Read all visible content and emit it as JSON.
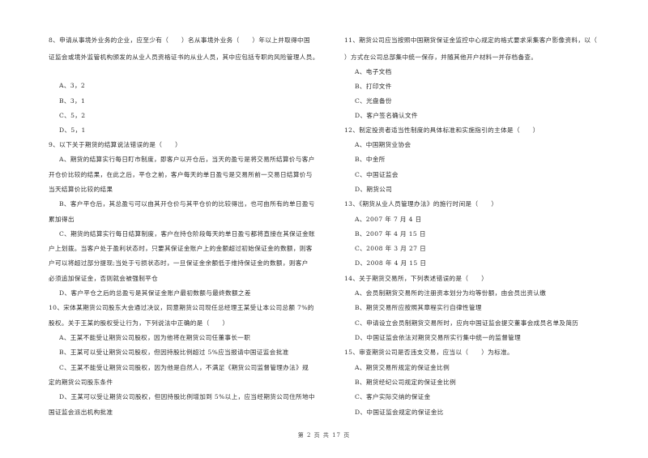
{
  "document": {
    "footer": "第 2 页 共 17 页",
    "left_column": [
      {
        "number": "8",
        "stem_lines": [
          "8、申请从事境外业务的企业，应至少有（　　）名从事境外业务（　　）年以上并取得中国",
          "证监会或境外监管机构颁发的从业人员资格证书的从业人员，其中应包括专职的风险管理人员。"
        ],
        "options": [
          "A、3，2",
          "B、3，1",
          "C、5，2",
          "D、5，1"
        ]
      },
      {
        "number": "9",
        "stem_lines": [
          "9、以下关于期货的结算说法错误的是（　　）"
        ],
        "options_lines": [
          [
            "A、期货的结算实行每日盯市制度，即客户以开仓后，当天的盈亏是将交易所结算价与客户",
            "开仓价比较的结果，在此之后，平仓之前，客户每天的单日盈亏是交易所前一交易日结算价与",
            "当天结算价比较的结果"
          ],
          [
            "B、客户平仓后，其总盈亏可以由其开仓价与其平仓价的比较得出，也可由所有的单日盈亏",
            "累加得出"
          ],
          [
            "C、期货的结算实行每日结算制度，客户在持仓阶段每天的单日盈亏都将直接在其保证金账",
            "户上划拨。当客户处于盈利状态时，只要其保证金账户上的金额超过初始保证金的数额，则客",
            "户可以将超过部分提现;当处于亏损状态时，一旦保证金余额低于维持保证金的数额，则客户",
            "必须追加保证金，否则就会被强制平仓"
          ],
          [
            "D、客户平仓之后的总盈亏是其保证金账户最初数额与最终数额之差"
          ]
        ]
      },
      {
        "number": "10",
        "stem_lines": [
          "10、宋体某期货公司股东大会通过决议，同意期货公司现任总经理王某受让本公司总额 7%的",
          "股权。关于王某的股权受让行为，下列说法中正确的是（　　）"
        ],
        "options_lines": [
          [
            "A、王某不能受让期货公司股权，因为他将在期货公司任董事长一职"
          ],
          [
            "B、王某可以受让期货公司股权，但因持股比例超过 5%应当报请中国证监会批准"
          ],
          [
            "C、王某不能受让期货公司股权，因为他是自然人，不满足《期货公司监督管理办法》规",
            "定的期货公司股东条件"
          ],
          [
            "D、王某可以受让期货公司股权，但因持股比例增加到 5%以上，应当经期货公司住所地中",
            "国证监会派出机构批准"
          ]
        ]
      }
    ],
    "right_column": [
      {
        "number": "11",
        "stem_lines": [
          "11、期货公司应当按照中国期货保证金监控中心规定的格式要求采集客户影像资料，以（",
          "）方式在公司总部集中统一保存，并随其他开户材料一并存档备查。"
        ],
        "options": [
          "A、电子文档",
          "B、打印文件",
          "C、光盘备份",
          "D、客户签名确认文件"
        ]
      },
      {
        "number": "12",
        "stem_lines": [
          "12、制定投资者适当性制度的具体标准和实施指引的主体是（　　）"
        ],
        "options": [
          "A、中国期货业协会",
          "B、中金所",
          "C、中国证监会",
          "D、期货公司"
        ]
      },
      {
        "number": "13",
        "stem_lines": [
          "13、《期货从业人员管理办法》的施行时间是（　　）"
        ],
        "options": [
          "A、2007 年 7 月 4 日",
          "B、2007 年 4 月 15 日",
          "C、2008 年 3 月 27 日",
          "D、2008 年 4 月 15 日"
        ]
      },
      {
        "number": "14",
        "stem_lines": [
          "14、关于期货交易所，下列表述错误的是（　　）"
        ],
        "options": [
          "A、会员制期货交易所的注册资本划分为均等份额，由会员出资认缴",
          "B、期货交易所应按照其章程实行自律性管理",
          "C、申请设立会员制期货交易所时，应向中国证监会提交董事会成员名单及简历",
          "D、中国证监会依法对期货交易所实行集中统一的监督管理"
        ]
      },
      {
        "number": "15",
        "stem_lines": [
          "15、审查期货公司是否违支交易，应当以（　　）为标准。"
        ],
        "options": [
          "A、期货交易所规定的保证金比例",
          "B、期货经纪公司规定的保证金比例",
          "C、客户实际交纳的保证金",
          "D、中国证监会规定的保证金比"
        ]
      }
    ]
  }
}
